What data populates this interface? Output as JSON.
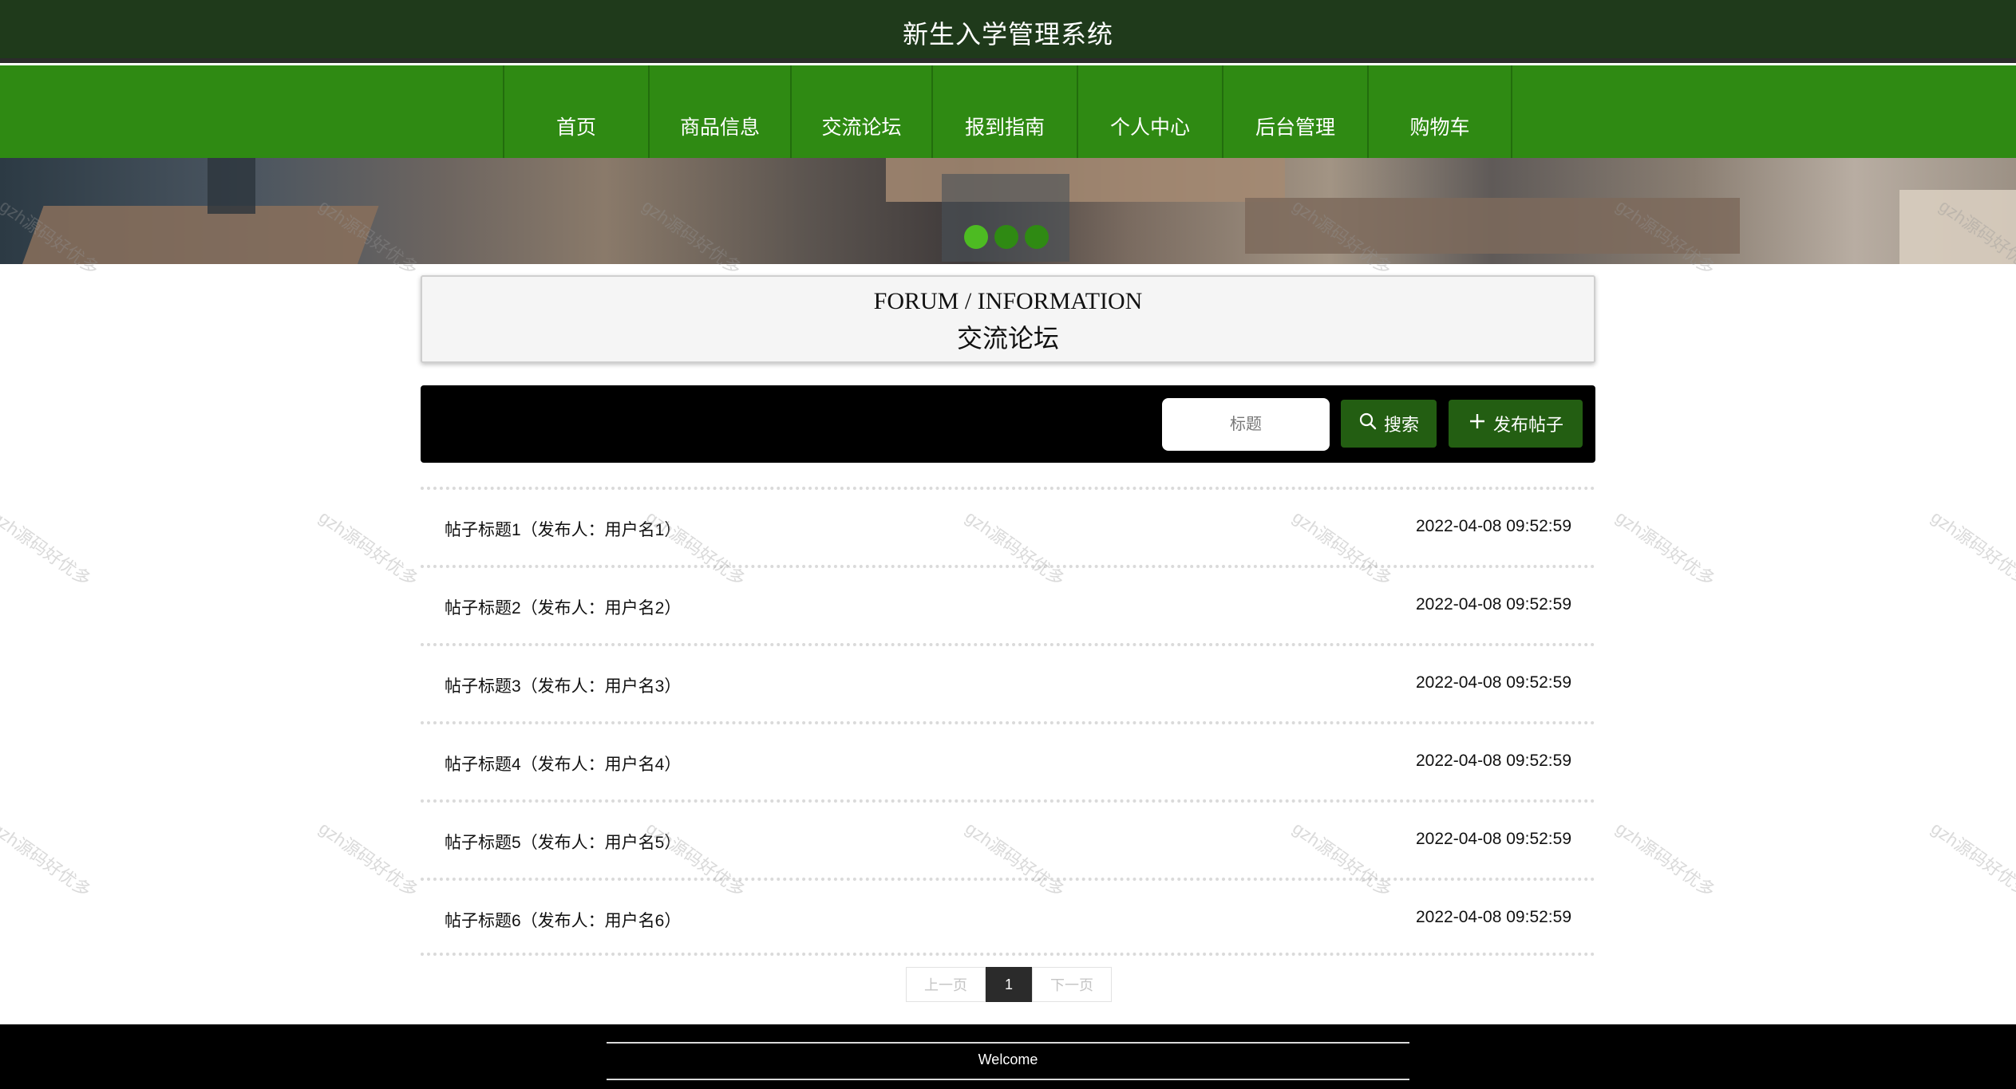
{
  "header": {
    "title": "新生入学管理系统"
  },
  "nav": {
    "items": [
      {
        "label": "首页"
      },
      {
        "label": "商品信息"
      },
      {
        "label": "交流论坛"
      },
      {
        "label": "报到指南"
      },
      {
        "label": "个人中心"
      },
      {
        "label": "后台管理"
      },
      {
        "label": "购物车"
      }
    ]
  },
  "banner": {
    "dot_count": 3,
    "active_dot": 1
  },
  "section": {
    "title_en": "FORUM / INFORMATION",
    "title_cn": "交流论坛"
  },
  "search": {
    "placeholder": "标题",
    "search_label": "搜索",
    "search_icon": "search-icon",
    "post_label": "发布帖子",
    "post_icon": "plus-icon"
  },
  "posts": [
    {
      "title": "帖子标题1（发布人：用户名1）",
      "time": "2022-04-08 09:52:59"
    },
    {
      "title": "帖子标题2（发布人：用户名2）",
      "time": "2022-04-08 09:52:59"
    },
    {
      "title": "帖子标题3（发布人：用户名3）",
      "time": "2022-04-08 09:52:59"
    },
    {
      "title": "帖子标题4（发布人：用户名4）",
      "time": "2022-04-08 09:52:59"
    },
    {
      "title": "帖子标题5（发布人：用户名5）",
      "time": "2022-04-08 09:52:59"
    },
    {
      "title": "帖子标题6（发布人：用户名6）",
      "time": "2022-04-08 09:52:59"
    }
  ],
  "pagination": {
    "prev_label": "上一页",
    "current_page": "1",
    "next_label": "下一页"
  },
  "footer": {
    "text": "Welcome"
  },
  "watermark": {
    "text": "gzh源码好优多"
  },
  "colors": {
    "header_bg": "#1f3a1b",
    "nav_bg": "#2f8a13",
    "button_bg": "#235e12",
    "search_bar_bg": "#000000",
    "footer_bg": "#000000"
  }
}
